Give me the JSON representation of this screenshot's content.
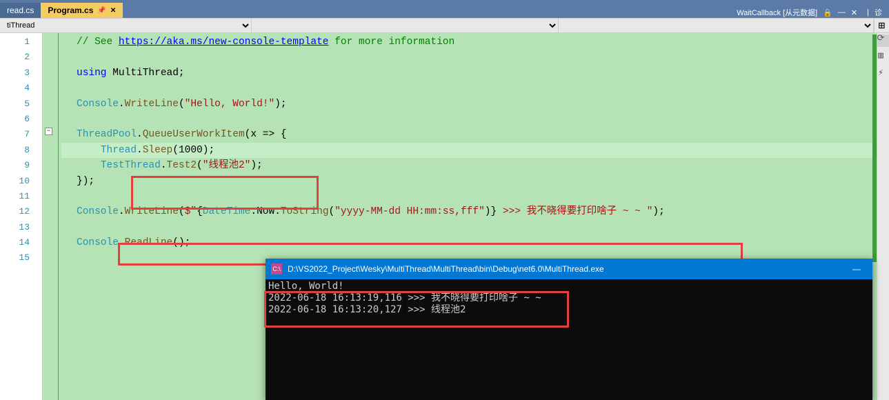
{
  "tabs": {
    "inactive": "read.cs",
    "active": "Program.cs"
  },
  "rightTabs": {
    "waitcallback": "WaitCallback [从元数据]",
    "diag": "诊"
  },
  "contextBar": {
    "left": "tiThread"
  },
  "lineNumbers": [
    "1",
    "2",
    "3",
    "4",
    "5",
    "6",
    "7",
    "8",
    "9",
    "10",
    "11",
    "12",
    "13",
    "14",
    "15"
  ],
  "code": {
    "l1_comment": "// See ",
    "l1_link": "https://aka.ms/new-console-template",
    "l1_rest": " for more information",
    "l3_using": "using",
    "l3_ns": " MultiThread;",
    "l5_console": "Console",
    "l5_dot": ".",
    "l5_write": "WriteLine",
    "l5_open": "(",
    "l5_str": "\"Hello, World!\"",
    "l5_close": ");",
    "l7_tp": "ThreadPool",
    "l7_dot": ".",
    "l7_queue": "QueueUserWorkItem",
    "l7_args": "(x => {",
    "l8_thread": "Thread",
    "l8_dot": ".",
    "l8_sleep": "Sleep",
    "l8_args": "(1000);",
    "l9_tt": "TestThread",
    "l9_dot": ".",
    "l9_test2": "Test2",
    "l9_open": "(",
    "l9_str": "\"线程池2\"",
    "l9_close": ");",
    "l10_close": "});",
    "l12_console": "Console",
    "l12_dot1": ".",
    "l12_write": "WriteLine",
    "l12_open": "(",
    "l12_dollar": "$\"",
    "l12_brace1": "{",
    "l12_dt": "DateTime",
    "l12_dot2": ".",
    "l12_now": "Now",
    "l12_dot3": ".",
    "l12_tostr": "ToString",
    "l12_open2": "(",
    "l12_fmt": "\"yyyy-MM-dd HH:mm:ss,fff\"",
    "l12_close2": ")",
    "l12_brace2": "}",
    "l12_rest": " >>> 我不晓得要打印啥子 ~ ~ \"",
    "l12_end": ");",
    "l14_console": "Console",
    "l14_dot": ".",
    "l14_readline": "ReadLine",
    "l14_args": "();"
  },
  "console": {
    "title": "D:\\VS2022_Project\\Wesky\\MultiThread\\MultiThread\\bin\\Debug\\net6.0\\MultiThread.exe",
    "line1": "Hello, World!",
    "line2": "2022-06-18 16:13:19,116 >>> 我不晓得要打印啥子 ~ ~",
    "line3": "2022-06-18 16:13:20,127 >>> 线程池2",
    "cursor": "_"
  }
}
